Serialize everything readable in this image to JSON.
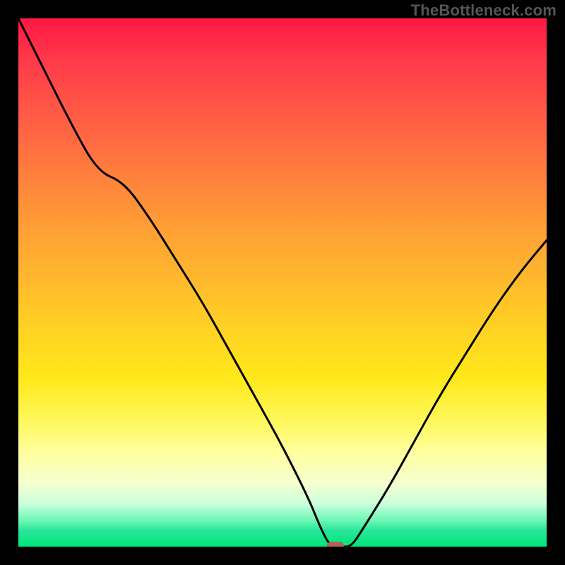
{
  "watermark_text": "TheBottleneck.com",
  "colors": {
    "frame": "#000000",
    "curve": "#000000",
    "marker": "#b0635a",
    "gradient_top": "#ff1744",
    "gradient_bottom": "#00e676"
  },
  "chart_data": {
    "type": "line",
    "title": "",
    "xlabel": "",
    "ylabel": "",
    "xlim": [
      0,
      100
    ],
    "ylim": [
      0,
      100
    ],
    "x": [
      0,
      5,
      10,
      15,
      20,
      25,
      30,
      35,
      40,
      45,
      50,
      55,
      57,
      59,
      61,
      63,
      65,
      70,
      75,
      80,
      85,
      90,
      95,
      100
    ],
    "values": [
      100,
      90,
      80,
      71,
      69,
      62,
      54,
      46,
      37,
      28,
      19,
      9,
      4,
      0,
      0,
      0,
      3,
      11,
      20,
      29,
      37,
      45,
      52,
      58
    ],
    "series": [
      {
        "name": "bottleneck-curve",
        "x_ref": "x",
        "values_ref": "values"
      }
    ],
    "annotations": [
      {
        "name": "optimal-point",
        "x": 60,
        "y": 0
      }
    ],
    "grid": false,
    "legend": false
  }
}
